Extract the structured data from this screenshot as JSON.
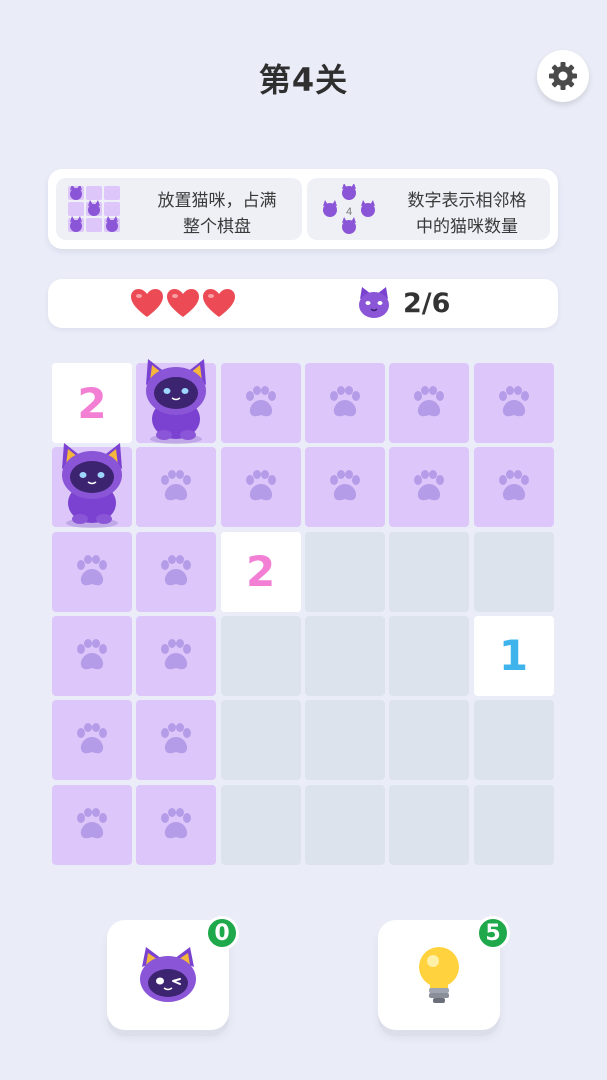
{
  "header": {
    "title": "第4关",
    "settings_icon": "gear-icon"
  },
  "hints": [
    {
      "icon": "mini-board-with-cats-icon",
      "line1": "放置猫咪，占满",
      "line2": "整个棋盘"
    },
    {
      "icon": "number-with-adjacent-cats-icon",
      "mini_number": "4",
      "line1": "数字表示相邻格",
      "line2": "中的猫咪数量"
    }
  ],
  "status": {
    "lives": 3,
    "heart_icon": "heart-icon",
    "cat_icon": "cat-face-icon",
    "cat_count": "2/6"
  },
  "board": {
    "rows": 6,
    "cols": 6,
    "cells": [
      [
        "n2",
        "cat",
        "paw",
        "paw",
        "paw",
        "paw"
      ],
      [
        "cat",
        "paw",
        "paw",
        "paw",
        "paw",
        "paw"
      ],
      [
        "paw",
        "paw",
        "n2",
        "empty",
        "empty",
        "empty"
      ],
      [
        "paw",
        "paw",
        "empty",
        "empty",
        "empty",
        "n1"
      ],
      [
        "paw",
        "paw",
        "empty",
        "empty",
        "empty",
        "empty"
      ],
      [
        "paw",
        "paw",
        "empty",
        "empty",
        "empty",
        "empty"
      ]
    ],
    "numbers": {
      "n2": "2",
      "n1": "1"
    },
    "number_colors": {
      "n2": "#f27fd4",
      "n1": "#3fb4ec"
    },
    "colors": {
      "paw_cell": "#ddc7fa",
      "empty_cell": "#dde3ec",
      "number_cell": "#ffffff",
      "paw_mark": "#b59ce8"
    }
  },
  "tools": {
    "cat_tool": {
      "icon": "winking-cat-icon",
      "count": "0"
    },
    "hint_tool": {
      "icon": "lightbulb-icon",
      "count": "5"
    }
  }
}
